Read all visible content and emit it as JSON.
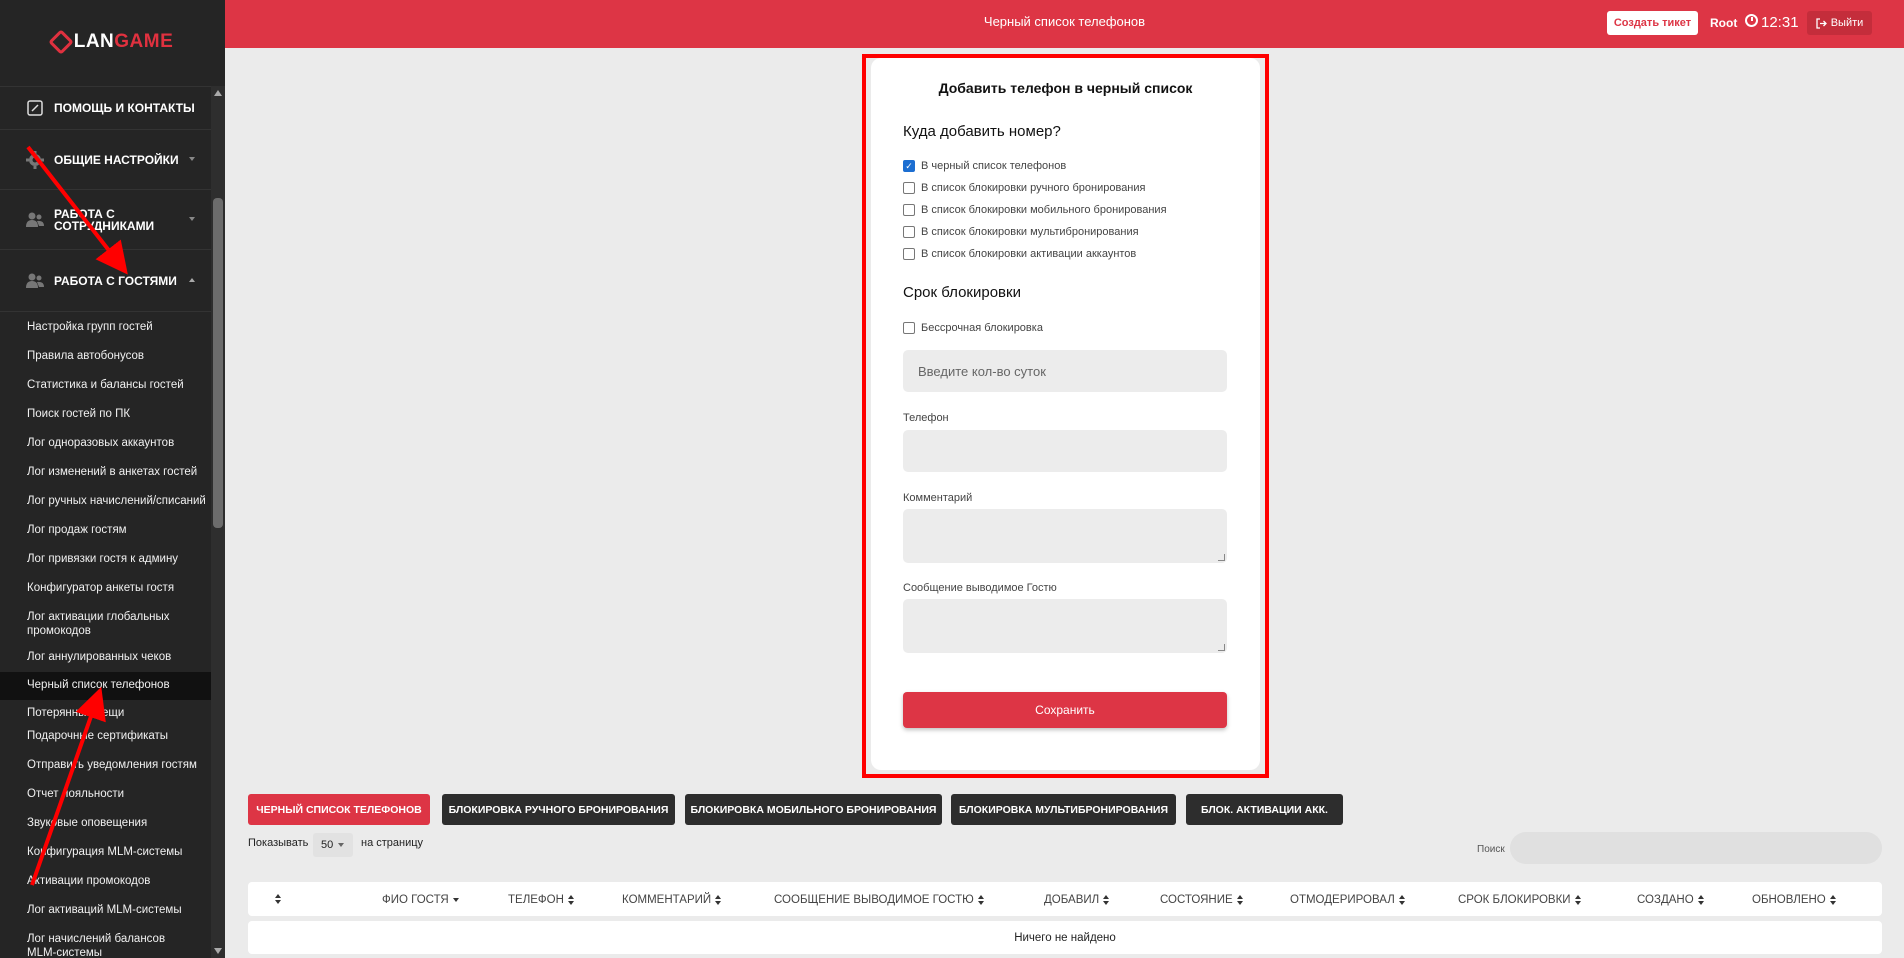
{
  "logo": {
    "lan": "LAN",
    "game": "GAME"
  },
  "header": {
    "title": "Черный список телефонов",
    "create_ticket": "Создать тикет",
    "user": "Root",
    "time": "12:31",
    "logout": "Выйти"
  },
  "sidebar": {
    "sections": [
      {
        "label": "Помощь и контакты",
        "icon": "edit-icon"
      },
      {
        "label": "Общие настройки",
        "icon": "gear-icon"
      },
      {
        "label": "Работа с сотрудниками",
        "icon": "users-icon"
      },
      {
        "label": "Работа с гостями",
        "icon": "users-icon"
      }
    ],
    "items": [
      "Настройка групп гостей",
      "Правила автобонусов",
      "Статистика и балансы гостей",
      "Поиск гостей по ПК",
      "Лог одноразовых аккаунтов",
      "Лог изменений в анкетах гостей",
      "Лог ручных начислений/списаний",
      "Лог продаж гостям",
      "Лог привязки гостя к админу",
      "Конфигуратор анкеты гостя",
      "Лог активации глобальных промокодов",
      "Лог аннулированных чеков",
      "Черный список телефонов",
      "Потерянные вещи",
      "Подарочные сертификаты",
      "Отправить уведомления гостям",
      "Отчет лояльности",
      "Звуковые оповещения",
      "Конфигурация MLM-системы",
      "Активации промокодов",
      "Лог активаций MLM-системы",
      "Лог начислений балансов MLM-системы"
    ]
  },
  "modal": {
    "title": "Добавить телефон в черный список",
    "where_heading": "Куда добавить номер?",
    "targets": [
      {
        "label": "В черный список телефонов",
        "checked": true
      },
      {
        "label": "В список блокировки ручного бронирования",
        "checked": false
      },
      {
        "label": "В список блокировки мобильного бронирования",
        "checked": false
      },
      {
        "label": "В список блокировки мультибронирования",
        "checked": false
      },
      {
        "label": "В список блокировки активации аккаунтов",
        "checked": false
      }
    ],
    "term_heading": "Срок блокировки",
    "indefinite": {
      "label": "Бессрочная блокировка",
      "checked": false
    },
    "days_placeholder": "Введите кол-во суток",
    "phone_label": "Телефон",
    "comment_label": "Комментарий",
    "message_label": "Сообщение выводимое Гостю",
    "save": "Сохранить"
  },
  "tabs": [
    "Черный список телефонов",
    "Блокировка ручного бронирования",
    "Блокировка мобильного бронирования",
    "Блокировка мультибронирования",
    "Блок. активации акк."
  ],
  "table": {
    "show_label": "Показывать",
    "page_size": "50",
    "per_page": "на страницу",
    "search_label": "Поиск",
    "columns": [
      "",
      "ФИО ГОСТЯ",
      "ТЕЛЕФОН",
      "КОММЕНТАРИЙ",
      "СООБЩЕНИЕ ВЫВОДИМОЕ ГОСТЮ",
      "ДОБАВИЛ",
      "СОСТОЯНИЕ",
      "ОТМОДЕРИРОВАЛ",
      "СРОК БЛОКИРОВКИ",
      "СОЗДАНО",
      "ОБНОВЛЕНО"
    ],
    "empty": "Ничего не найдено"
  },
  "colors": {
    "accent": "#dd3545",
    "sidebar": "#252525",
    "highlight": "#ff0000"
  }
}
